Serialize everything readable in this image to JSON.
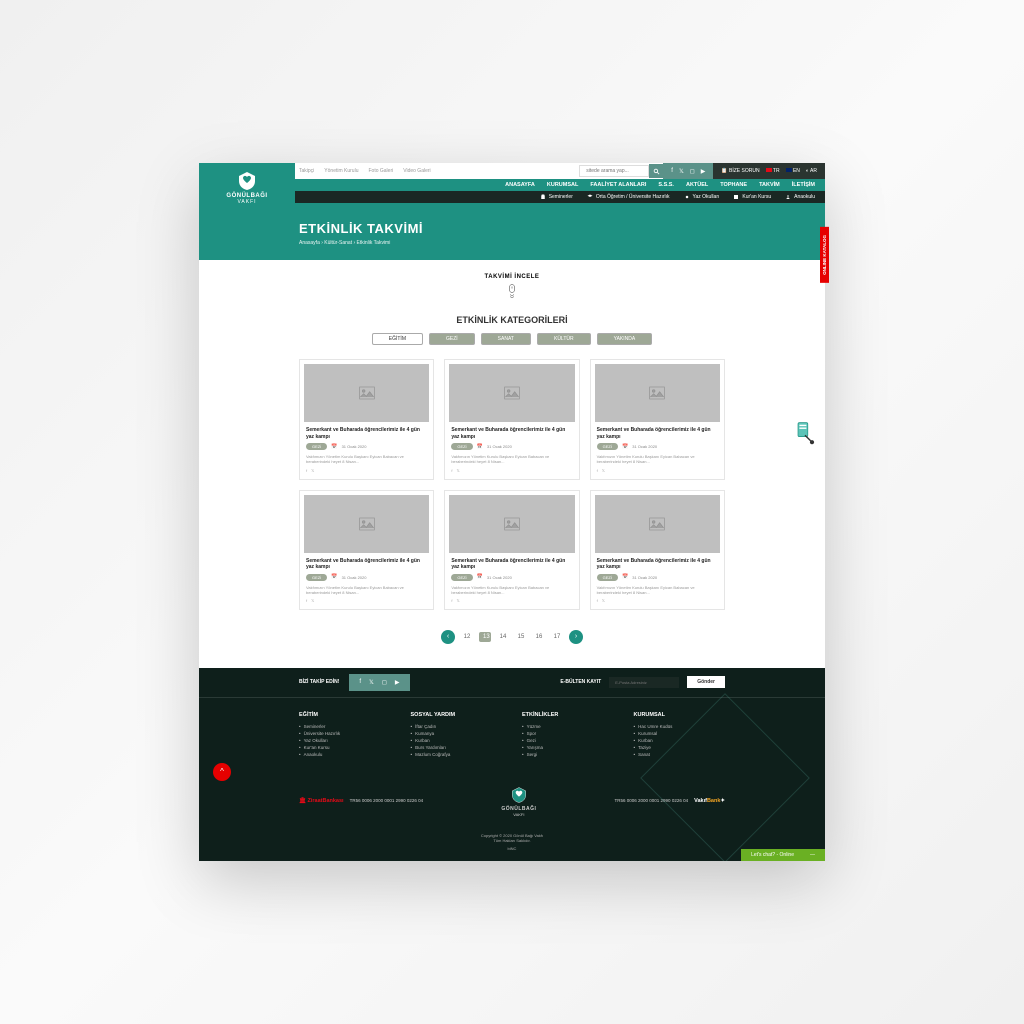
{
  "logo": {
    "main": "GÖNÜLBAĞI",
    "sub": "VAKFI"
  },
  "topbar_links": [
    "Takipçi",
    "Yönetim Kurulu",
    "Foto Galeri",
    "Video Galeri"
  ],
  "search_placeholder": "sitede arama yap...",
  "topright": {
    "login": "BİZE SORUN",
    "lang_tr": "TR",
    "lang_en": "EN",
    "lang_ar": "AR"
  },
  "nav": [
    "ANASAYFA",
    "KURUMSAL",
    "FAALİYET ALANLARI",
    "S.S.S.",
    "AKTÜEL",
    "TOPHANE",
    "TAKVİM",
    "İLETİŞİM"
  ],
  "subnav": [
    "Seminerler",
    "Orta Öğretim / Üniversite Hazırlık",
    "Yaz Okulları",
    "Kur'an Kursu",
    "Anaokulu"
  ],
  "hero": {
    "title": "ETKİNLİK TAKVİMİ",
    "crumbs": "Anasayfa  ›  Kültür-Sanat  ›  Etkinlik Takvimi"
  },
  "katalog": "ONLINE KATALOG",
  "section_label": "TAKVİMİ İNCELE",
  "cat_title": "ETKİNLİK KATEGORİLERİ",
  "tabs": [
    "EĞİTİM",
    "GEZİ",
    "SANAT",
    "KÜLTÜR",
    "YAKINDA"
  ],
  "card": {
    "title": "Semerkant ve Buharada öğrencilerimiz ile 4 gün yaz kampı",
    "badge": "GEZİ",
    "date": "31 Ocak 2020",
    "desc": "Vakfımızın Yönetim Kurulu Başkanı Eyican Babacan ve beraberindeki heyet 8 Nisan..."
  },
  "pages": [
    "12",
    "13",
    "14",
    "15",
    "16",
    "17"
  ],
  "footer": {
    "follow": "BİZİ TAKİP EDİN!",
    "nl_label": "E-BÜLTEN KAYIT",
    "nl_placeholder": "E-Posta Adresiniz",
    "nl_btn": "Gönder",
    "cols": [
      {
        "h": "EĞİTİM",
        "items": [
          "Seminerler",
          "Üniversite Hazırlık",
          "Yaz Okulları",
          "Kur'an Kursu",
          "Anaokulu"
        ]
      },
      {
        "h": "SOSYAL YARDIM",
        "items": [
          "İftar Çadırı",
          "Kumanya",
          "Kurban",
          "Burs Yardımları",
          "Mazlum Coğrafya"
        ]
      },
      {
        "h": "ETKİNLİKLER",
        "items": [
          "Yüzme",
          "Spor",
          "Gezi",
          "Yarışma",
          "Sergi"
        ]
      },
      {
        "h": "KURUMSAL",
        "items": [
          "Hac Umre Kudüs",
          "Kurumsal",
          "Kurban",
          "Taziye",
          "Sanat"
        ]
      }
    ],
    "iban": "TR56 0006 2000 0001 2990 0226 04",
    "copy1": "Copyright © 2020 Gönül Bağı Vakfı",
    "copy2": "Tüm Hakları Saklıdır.",
    "copy3": "biNC"
  },
  "chat": "Let's chat? - Online"
}
